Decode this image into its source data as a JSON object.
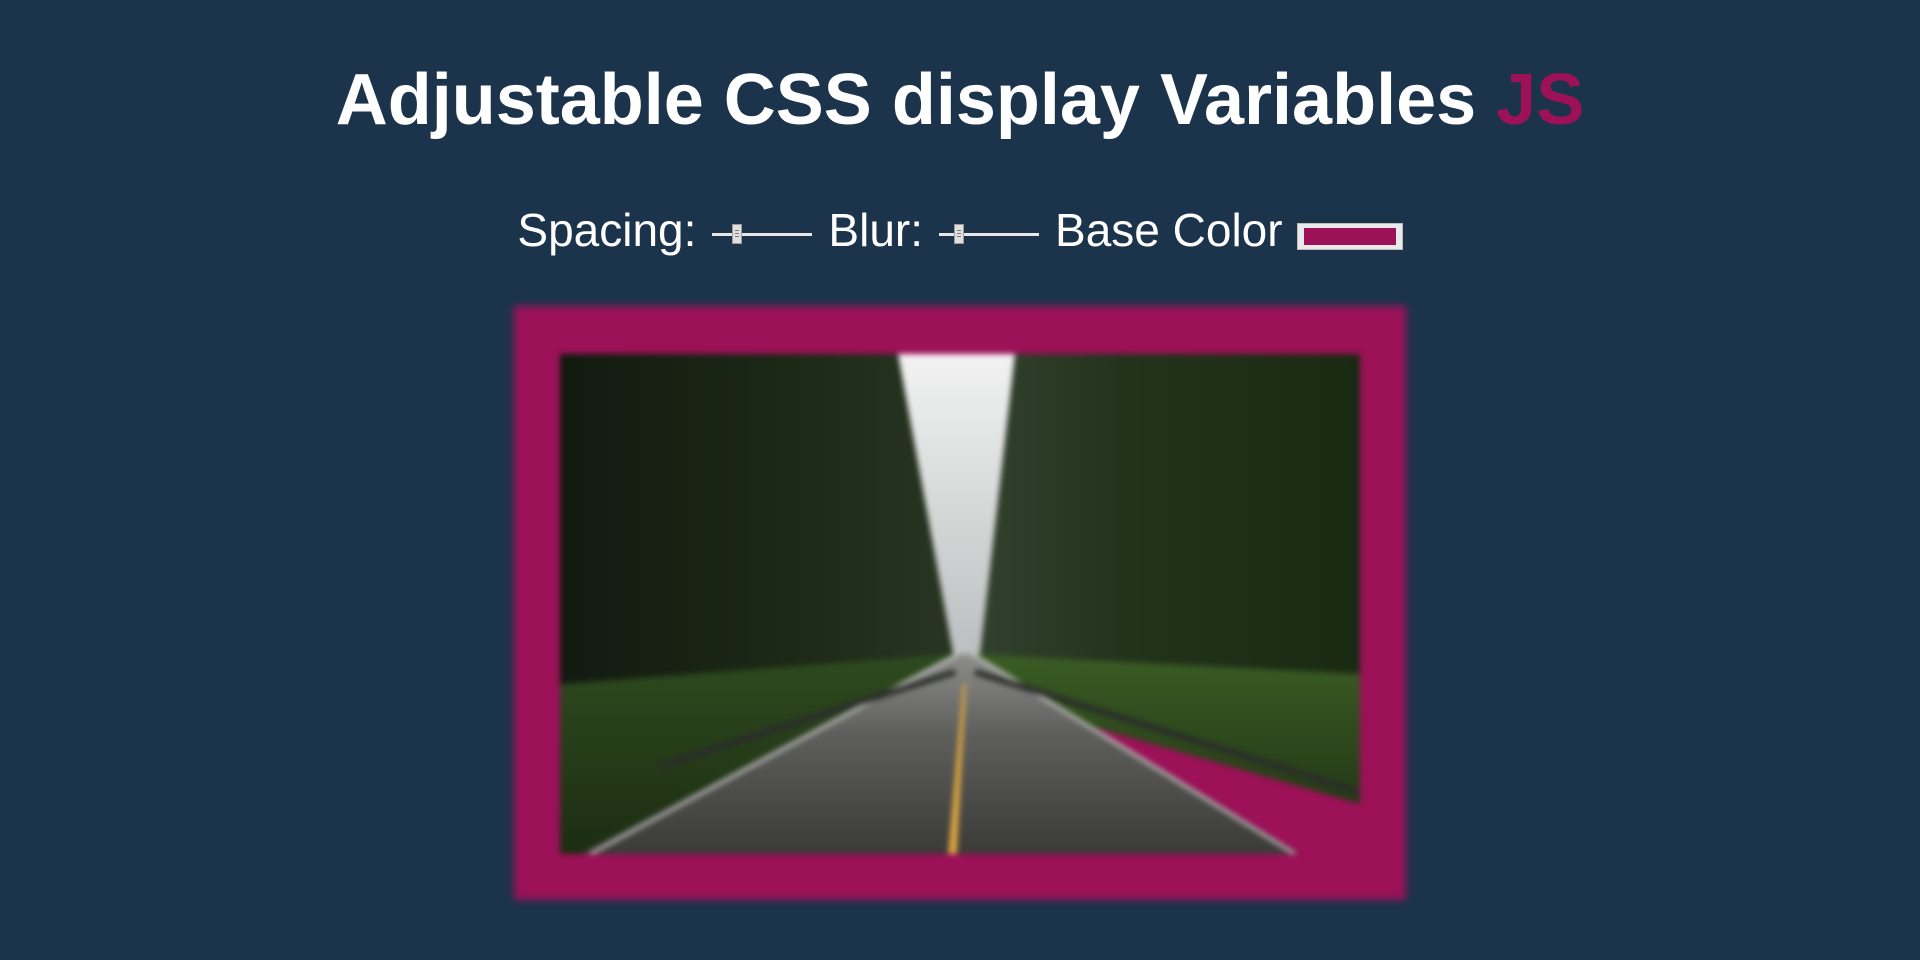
{
  "header": {
    "title_main": "Adjustable CSS display Variables ",
    "title_highlight": "JS"
  },
  "controls": {
    "spacing_label": "Spacing:",
    "spacing_value": 0.25,
    "blur_label": "Blur:",
    "blur_value": 0.2,
    "base_color_label": "Base Color",
    "base_color_value": "#9c1158"
  },
  "colors": {
    "background": "#1b344b",
    "accent": "#9c1158",
    "text": "#ffffff"
  },
  "image": {
    "subject": "forest-road-photo"
  }
}
